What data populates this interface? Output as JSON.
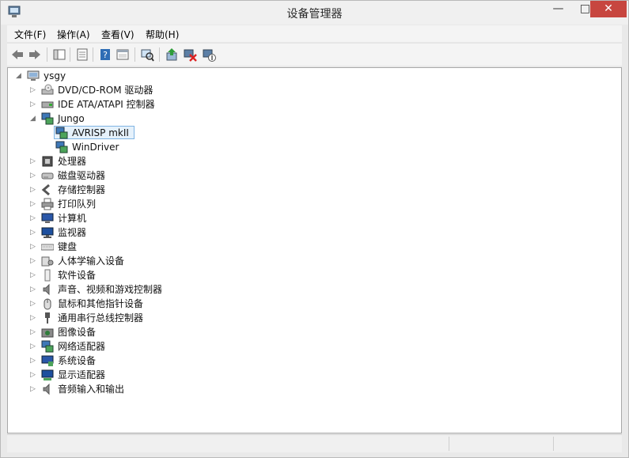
{
  "window": {
    "title": "设备管理器"
  },
  "menu": [
    "文件(F)",
    "操作(A)",
    "查看(V)",
    "帮助(H)"
  ],
  "tree": {
    "root": "ysgy",
    "items": [
      {
        "label": "DVD/CD-ROM 驱动器",
        "icon": "disc-drive-icon"
      },
      {
        "label": "IDE ATA/ATAPI 控制器",
        "icon": "ide-controller-icon"
      },
      {
        "label": "Jungo",
        "icon": "usb-device-icon",
        "expanded": true,
        "children": [
          {
            "label": "AVRISP mkII",
            "icon": "usb-device-icon",
            "selected": true
          },
          {
            "label": "WinDriver",
            "icon": "usb-device-icon"
          }
        ]
      },
      {
        "label": "处理器",
        "icon": "processor-icon"
      },
      {
        "label": "磁盘驱动器",
        "icon": "disk-drive-icon"
      },
      {
        "label": "存储控制器",
        "icon": "storage-controller-icon"
      },
      {
        "label": "打印队列",
        "icon": "printer-icon"
      },
      {
        "label": "计算机",
        "icon": "computer-icon"
      },
      {
        "label": "监视器",
        "icon": "monitor-icon"
      },
      {
        "label": "键盘",
        "icon": "keyboard-icon"
      },
      {
        "label": "人体学输入设备",
        "icon": "hid-icon"
      },
      {
        "label": "软件设备",
        "icon": "software-device-icon"
      },
      {
        "label": "声音、视频和游戏控制器",
        "icon": "speaker-icon"
      },
      {
        "label": "鼠标和其他指针设备",
        "icon": "mouse-icon"
      },
      {
        "label": "通用串行总线控制器",
        "icon": "usb-plug-icon"
      },
      {
        "label": "图像设备",
        "icon": "camera-icon"
      },
      {
        "label": "网络适配器",
        "icon": "network-adapter-icon"
      },
      {
        "label": "系统设备",
        "icon": "system-device-icon"
      },
      {
        "label": "显示适配器",
        "icon": "display-adapter-icon"
      },
      {
        "label": "音频输入和输出",
        "icon": "audio-io-icon"
      }
    ]
  },
  "toolbar_icons": [
    "back-icon",
    "forward-icon",
    "show-hide-tree-icon",
    "properties-icon",
    "help-icon",
    "view-icon",
    "scan-hardware-icon",
    "update-driver-icon",
    "uninstall-icon",
    "disable-icon"
  ]
}
